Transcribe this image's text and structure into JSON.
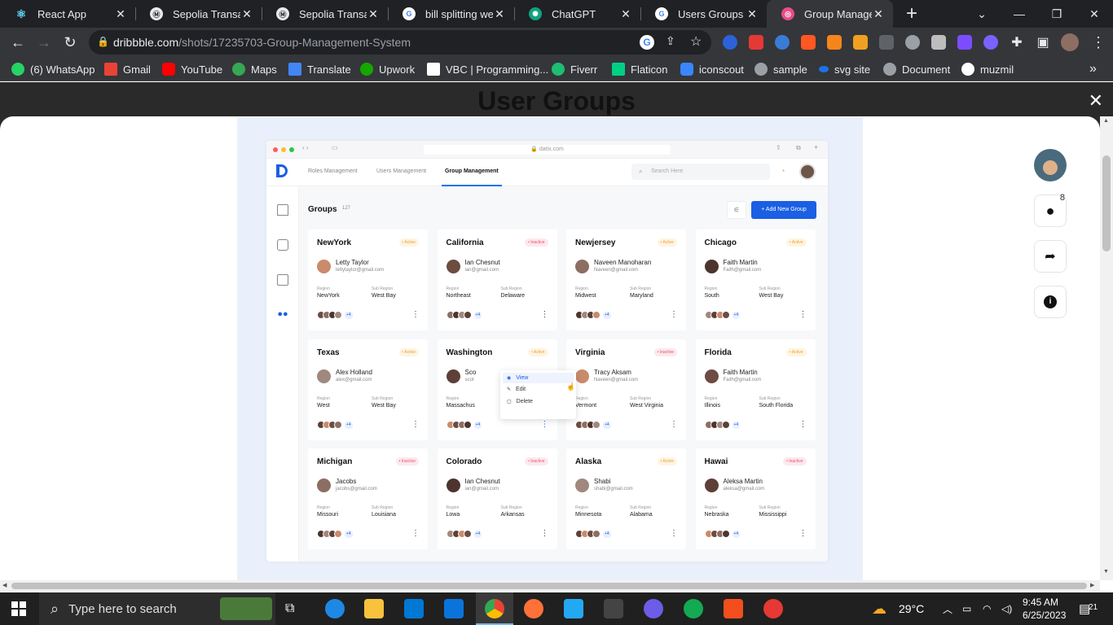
{
  "browser": {
    "tabs": [
      {
        "title": "React App",
        "favicon": "react-icon",
        "color": "#61dafb"
      },
      {
        "title": "Sepolia Transactio",
        "favicon": "etherscan-icon",
        "color": "#e8eaed"
      },
      {
        "title": "Sepolia Transactio",
        "favicon": "etherscan-icon",
        "color": "#e8eaed"
      },
      {
        "title": "bill splitting webs",
        "favicon": "google-icon",
        "color": "#4285f4"
      },
      {
        "title": "ChatGPT",
        "favicon": "chatgpt-icon",
        "color": "#10a37f"
      },
      {
        "title": "Users Groups Scr",
        "favicon": "google-icon",
        "color": "#4285f4"
      },
      {
        "title": "Group Manageme",
        "favicon": "dribbble-icon",
        "color": "#ea4c89",
        "active": true
      }
    ],
    "address": {
      "host": "dribbble.com",
      "path": "/shots/17235703-Group-Management-System"
    },
    "bookmarks": [
      {
        "label": "(6) WhatsApp",
        "icon": "whatsapp-icon",
        "color": "#25d366"
      },
      {
        "label": "Gmail",
        "icon": "gmail-icon",
        "color": "#ea4335"
      },
      {
        "label": "YouTube",
        "icon": "youtube-icon",
        "color": "#ff0000"
      },
      {
        "label": "Maps",
        "icon": "maps-icon",
        "color": "#34a853"
      },
      {
        "label": "Translate",
        "icon": "translate-icon",
        "color": "#4285f4"
      },
      {
        "label": "Upwork",
        "icon": "upwork-icon",
        "color": "#14a800"
      },
      {
        "label": "VBC | Programming...",
        "icon": "vbc-icon",
        "color": "#ffffff"
      },
      {
        "label": "Fiverr",
        "icon": "fiverr-icon",
        "color": "#1dbf73"
      },
      {
        "label": "Flaticon",
        "icon": "flaticon-icon",
        "color": "#00d084"
      },
      {
        "label": "iconscout",
        "icon": "iconscout-icon",
        "color": "#3a86ff"
      },
      {
        "label": "sample",
        "icon": "globe-icon",
        "color": "#9aa0a6"
      },
      {
        "label": "svg site",
        "icon": "svg-icon",
        "color": "#1a73e8"
      },
      {
        "label": "Document",
        "icon": "globe-icon",
        "color": "#9aa0a6"
      },
      {
        "label": "muzmil",
        "icon": "github-icon",
        "color": "#ffffff"
      }
    ],
    "more_bookmarks": "»"
  },
  "shot": {
    "title": "User Groups",
    "close": "✕",
    "comment_count": "8"
  },
  "mock": {
    "url": "🔒 datix.com",
    "nav": [
      "Roles Management",
      "Users Management",
      "Group Management"
    ],
    "search_placeholder": "Search Here",
    "groups_title": "Groups",
    "groups_count": "127",
    "add_button": "+ Add New Group",
    "labels": {
      "region": "Region",
      "sub_region": "Sub Region",
      "more": "⋮",
      "extra": "+4"
    },
    "cards": [
      {
        "name": "NewYork",
        "status": "Active",
        "person": "Letty Taylor",
        "email": "lettytaylor@gmail.com",
        "region": "NewYork",
        "sub_region": "West Bay"
      },
      {
        "name": "California",
        "status": "Inactive",
        "person": "Ian Chesnut",
        "email": "ian@gmail.com",
        "region": "Northeast",
        "sub_region": "Delaware"
      },
      {
        "name": "Newjersey",
        "status": "Active",
        "person": "Naveen Manoharan",
        "email": "Naveen@gmail.com",
        "region": "Midwest",
        "sub_region": "Maryland"
      },
      {
        "name": "Chicago",
        "status": "Active",
        "person": "Faith Martin",
        "email": "Faith@gmail.com",
        "region": "South",
        "sub_region": "West Bay"
      },
      {
        "name": "Texas",
        "status": "Active",
        "person": "Alex Holland",
        "email": "alex@gmail.com",
        "region": "West",
        "sub_region": "West Bay"
      },
      {
        "name": "Washington",
        "status": "Active",
        "person": "Sco",
        "email": "scot",
        "region": "Massachus",
        "sub_region": ""
      },
      {
        "name": "Virginia",
        "status": "Inactive",
        "person": "Tracy Aksam",
        "email": "Naveen@gmail.com",
        "region": "Vermont",
        "sub_region": "West Virginia"
      },
      {
        "name": "Florida",
        "status": "Active",
        "person": "Faith Martin",
        "email": "Faith@gmail.com",
        "region": "Illinois",
        "sub_region": "South Florida"
      },
      {
        "name": "Michigan",
        "status": "Inactive",
        "person": "Jacobs",
        "email": "jacobs@gmail.com",
        "region": "Missouri",
        "sub_region": "Louisiana"
      },
      {
        "name": "Colorado",
        "status": "Inactive",
        "person": "Ian Chesnut",
        "email": "ian@gmail.com",
        "region": "Lowa",
        "sub_region": "Arkansas"
      },
      {
        "name": "Alaska",
        "status": "Active",
        "person": "Shabi",
        "email": "shabi@gmail.com",
        "region": "Minnesota",
        "sub_region": "Alabama"
      },
      {
        "name": "Hawai",
        "status": "Inactive",
        "person": "Aleksa Martin",
        "email": "aleksa@gmail.com",
        "region": "Nebraska",
        "sub_region": "Mississippi"
      }
    ],
    "context_menu": [
      "View",
      "Edit",
      "Delete"
    ]
  },
  "taskbar": {
    "search_placeholder": "Type here to search",
    "weather": "29°C",
    "time": "9:45 AM",
    "date": "6/25/2023",
    "notification_count": "21"
  }
}
